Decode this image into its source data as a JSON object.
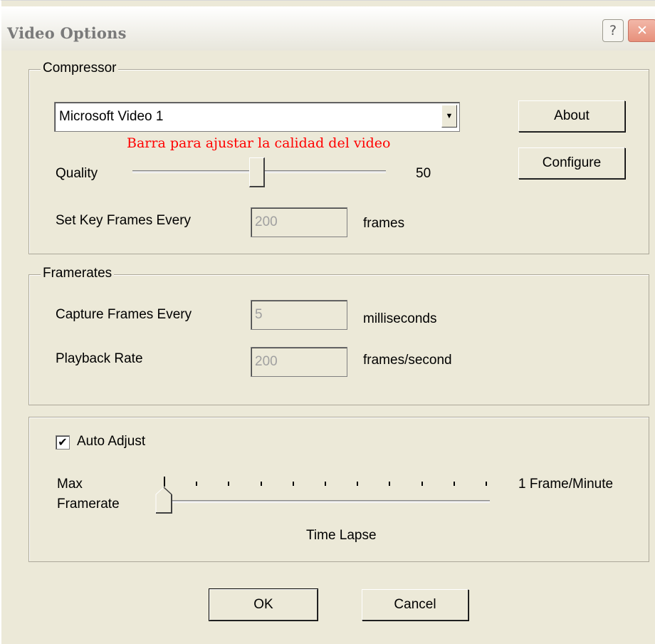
{
  "window": {
    "title": "Video Options",
    "help_glyph": "?",
    "close_glyph": "✕"
  },
  "compressor": {
    "legend": "Compressor",
    "codec_selected": "Microsoft Video 1",
    "dropdown_arrow": "▼",
    "annotation": "Barra para ajustar la calidad del video",
    "about_label": "About",
    "configure_label": "Configure",
    "quality_label": "Quality",
    "quality_value": "50",
    "keyframes_label": "Set Key Frames Every",
    "keyframes_value": "200",
    "keyframes_unit": "frames"
  },
  "framerates": {
    "legend": "Framerates",
    "capture_label": "Capture Frames Every",
    "capture_value": "5",
    "capture_unit": "milliseconds",
    "playback_label": "Playback Rate",
    "playback_value": "200",
    "playback_unit": "frames/second"
  },
  "timelapse": {
    "auto_adjust_label": "Auto Adjust",
    "auto_adjust_checked": true,
    "checkmark": "✔",
    "max_label_line1": "Max",
    "max_label_line2": "Framerate",
    "right_label": "1 Frame/Minute",
    "caption": "Time Lapse",
    "slider_position": 0
  },
  "footer": {
    "ok_label": "OK",
    "cancel_label": "Cancel"
  }
}
